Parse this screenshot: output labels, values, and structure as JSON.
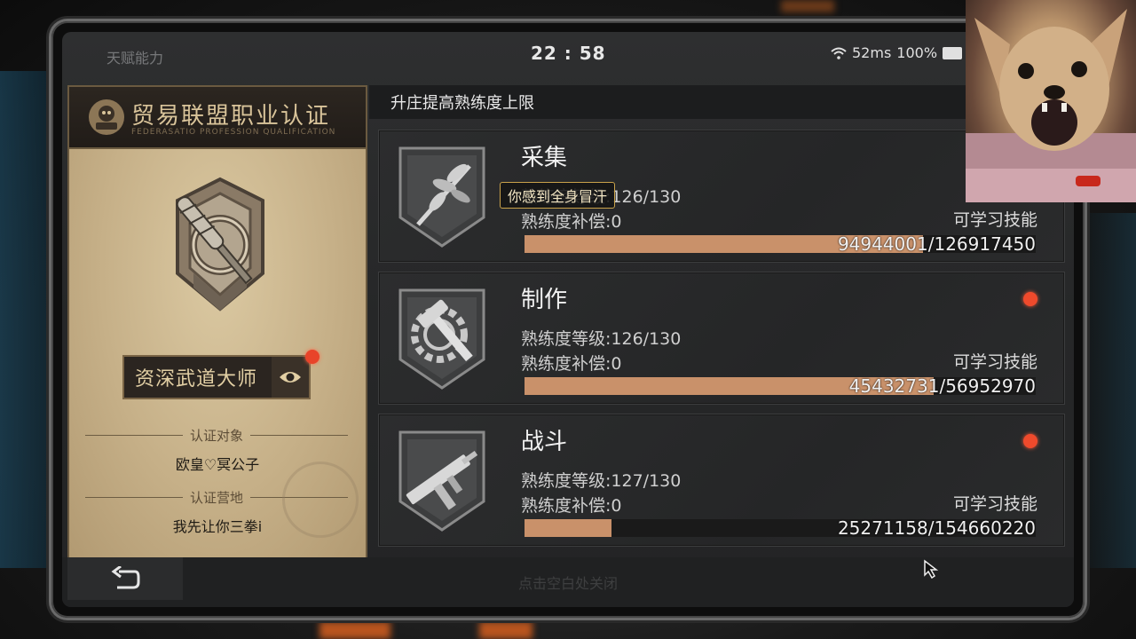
{
  "status_bar": {
    "left_label": "天赋能力",
    "time": "22 : 58",
    "ping": "52ms",
    "battery": "100%"
  },
  "certification": {
    "title": "贸易联盟职业认证",
    "subtitle": "FEDERASATIO PROFESSION QUALIFICATION",
    "rank": "资深武道大师",
    "target_label": "认证对象",
    "target_value": "欧皇♡冥公子",
    "camp_label": "认证营地",
    "camp_value": "我先让你三拳i"
  },
  "panel": {
    "header": "升庄提高熟练度上限",
    "tooltip": "你感到全身冒汗"
  },
  "skills": [
    {
      "name": "采集",
      "level": "熟练度等级:126/130",
      "compensation": "熟练度补偿:0",
      "learnable": "可学习技能",
      "progress": "94944001/126917450",
      "progress_fraction": 0.78,
      "has_notification": false,
      "icon": "leaf-branch-icon"
    },
    {
      "name": "制作",
      "level": "熟练度等级:126/130",
      "compensation": "熟练度补偿:0",
      "learnable": "可学习技能",
      "progress": "45432731/56952970",
      "progress_fraction": 0.8,
      "has_notification": true,
      "icon": "gear-hammer-icon"
    },
    {
      "name": "战斗",
      "level": "熟练度等级:127/130",
      "compensation": "熟练度补偿:0",
      "learnable": "可学习技能",
      "progress": "25271158/154660220",
      "progress_fraction": 0.17,
      "has_notification": true,
      "icon": "smg-gun-icon"
    }
  ],
  "bottom": {
    "close_hint": "点击空白处关闭"
  },
  "colors": {
    "progress_fill": "#c9916a",
    "notification": "#ef4a2c",
    "card_gold": "#c8b48e"
  }
}
